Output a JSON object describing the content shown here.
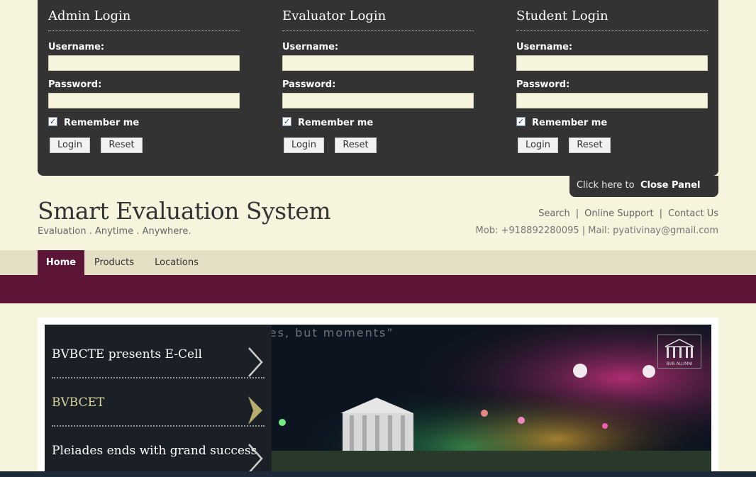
{
  "login_panel": {
    "columns": [
      {
        "title": "Admin Login",
        "username_label": "Username:",
        "username_value": "",
        "password_label": "Password:",
        "password_value": "",
        "remember_label": "Remember me",
        "remember_checked": true,
        "login_label": "Login",
        "reset_label": "Reset"
      },
      {
        "title": "Evaluator Login",
        "username_label": "Username:",
        "username_value": "",
        "password_label": "Password:",
        "password_value": "",
        "remember_label": "Remember me",
        "remember_checked": true,
        "login_label": "Login",
        "reset_label": "Reset"
      },
      {
        "title": "Student Login",
        "username_label": "Username:",
        "username_value": "",
        "password_label": "Password:",
        "password_value": "",
        "remember_label": "Remember me",
        "remember_checked": true,
        "login_label": "Login",
        "reset_label": "Reset"
      }
    ],
    "close_prefix": "Click here to",
    "close_label": "Close Panel"
  },
  "header": {
    "site_title": "Smart Evaluation System",
    "tagline": "Evaluation . Anytime . Anywhere.",
    "links": [
      "Search",
      "Online Support",
      "Contact Us"
    ],
    "contact_line": "Mob: +918892280095 | Mail: pyativinay@gmail.com"
  },
  "nav": {
    "items": [
      "Home",
      "Products",
      "Locations"
    ],
    "active": "Home"
  },
  "slider": {
    "quote": "“Life isn’t a matter of milestones, but moments”",
    "items": [
      "BVBCTE presents E-Cell",
      "BVBCET",
      "Pleiades ends with grand success"
    ],
    "active_index": 1,
    "logo_text": "BVB ALUMNI"
  },
  "colors": {
    "background": "#f6f4dc",
    "panel": "#333333",
    "accent": "#5c1437",
    "nav_bar": "#e4dfc5"
  }
}
